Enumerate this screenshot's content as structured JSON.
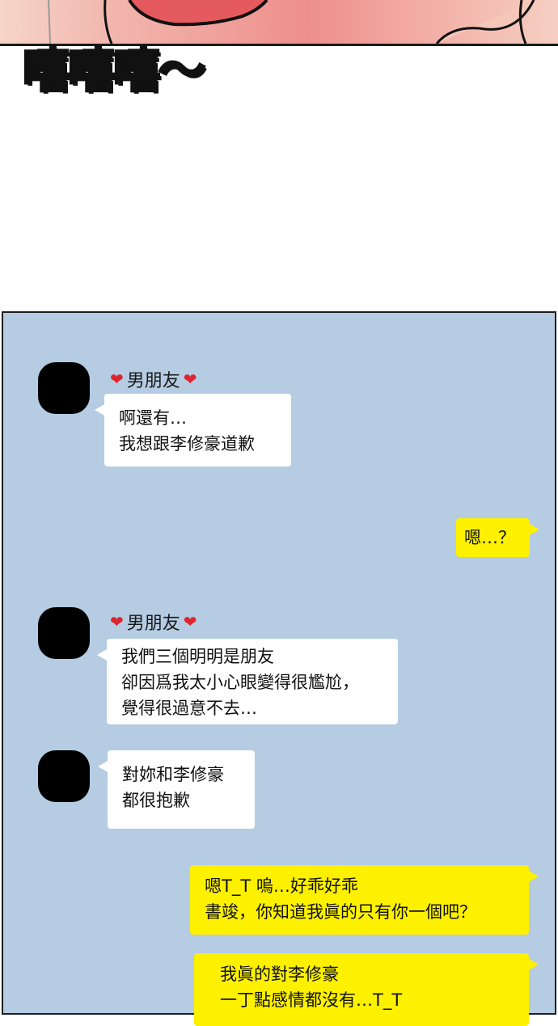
{
  "sound_effect": "嘻嘻嘻～",
  "colors": {
    "chat_bg": "#b5cce2",
    "my_bubble": "#fdf100",
    "their_bubble": "#ffffff",
    "heart": "#e0242c"
  },
  "icons": {
    "heart": "heart-icon",
    "avatar": "avatar-redacted"
  },
  "messages": [
    {
      "sender": "男朋友",
      "lines": [
        "啊還有…",
        "我想跟李修豪道歉"
      ]
    },
    {
      "sender": "me",
      "lines": [
        "嗯…？"
      ]
    },
    {
      "sender": "男朋友",
      "lines": [
        "我們三個明明是朋友",
        "卻因爲我太小心眼變得很尷尬，",
        "覺得很過意不去…"
      ]
    },
    {
      "sender": "男朋友",
      "lines": [
        "對妳和李修豪",
        "都很抱歉"
      ]
    },
    {
      "sender": "me",
      "lines": [
        "嗯T_T 嗚…好乖好乖",
        "書竣，你知道我眞的只有你一個吧？"
      ]
    },
    {
      "sender": "me",
      "lines": [
        "我眞的對李修豪",
        "一丁點感情都沒有…T_T"
      ]
    }
  ]
}
